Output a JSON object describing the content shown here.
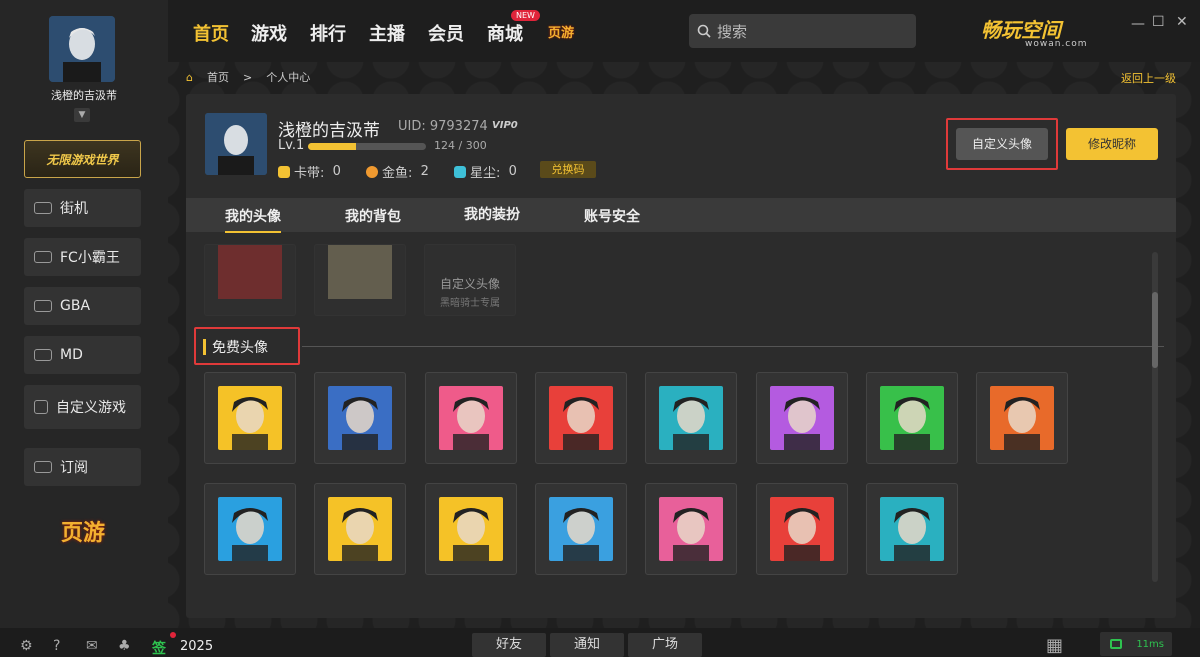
{
  "app": {
    "logo": "畅玩空间",
    "logo_sub": "wowan.com",
    "new_badge": "NEW",
    "yeyou": "页游"
  },
  "nav": [
    "首页",
    "游戏",
    "排行",
    "主播",
    "会员",
    "商城"
  ],
  "search": {
    "placeholder": "搜索"
  },
  "sidebar": {
    "nickname": "浅橙的吉汲芾",
    "banner": "无限游戏世界",
    "items": [
      "街机",
      "FC小霸王",
      "GBA",
      "MD",
      "自定义游戏",
      "订阅"
    ],
    "yeyou": "页游"
  },
  "breadcrumb": {
    "home": "首页",
    "sep": ">",
    "current": "个人中心",
    "back": "返回上一级"
  },
  "profile": {
    "name": "浅橙的吉汲芾",
    "uid": "UID: 9793274",
    "vip": "VIP0",
    "level": "Lv.1",
    "exp": "124 / 300",
    "exp_fraction": 0.41,
    "currency": [
      {
        "label": "卡带:",
        "value": "0",
        "color": "#f3c233"
      },
      {
        "label": "金鱼:",
        "value": "2",
        "color": "#f09a30"
      },
      {
        "label": "星尘:",
        "value": "0",
        "color": "#3ec0d8"
      }
    ],
    "exchange": "兑换码",
    "custom_avatar_btn": "自定义头像",
    "rename_btn": "修改昵称"
  },
  "tabs": [
    "我的头像",
    "我的背包",
    "我的装扮",
    "账号安全"
  ],
  "custom": {
    "label": "自定义头像",
    "sub": "黑暗骑士专属"
  },
  "free_title": "免费头像",
  "avatar_colors": [
    "#f5c227",
    "#3a6ec4",
    "#ef5b8a",
    "#e8403a",
    "#2ab0c0",
    "#b45be0",
    "#38c04a",
    "#e86a2a",
    "#2aa0e0",
    "#f5c227",
    "#f5c227",
    "#3aa0e0",
    "#e8609a",
    "#e8403a",
    "#2ab0c0"
  ],
  "footer": {
    "year": "2025",
    "sign": "签",
    "buttons": [
      "好友",
      "通知",
      "广场"
    ],
    "ping": "11ms"
  }
}
